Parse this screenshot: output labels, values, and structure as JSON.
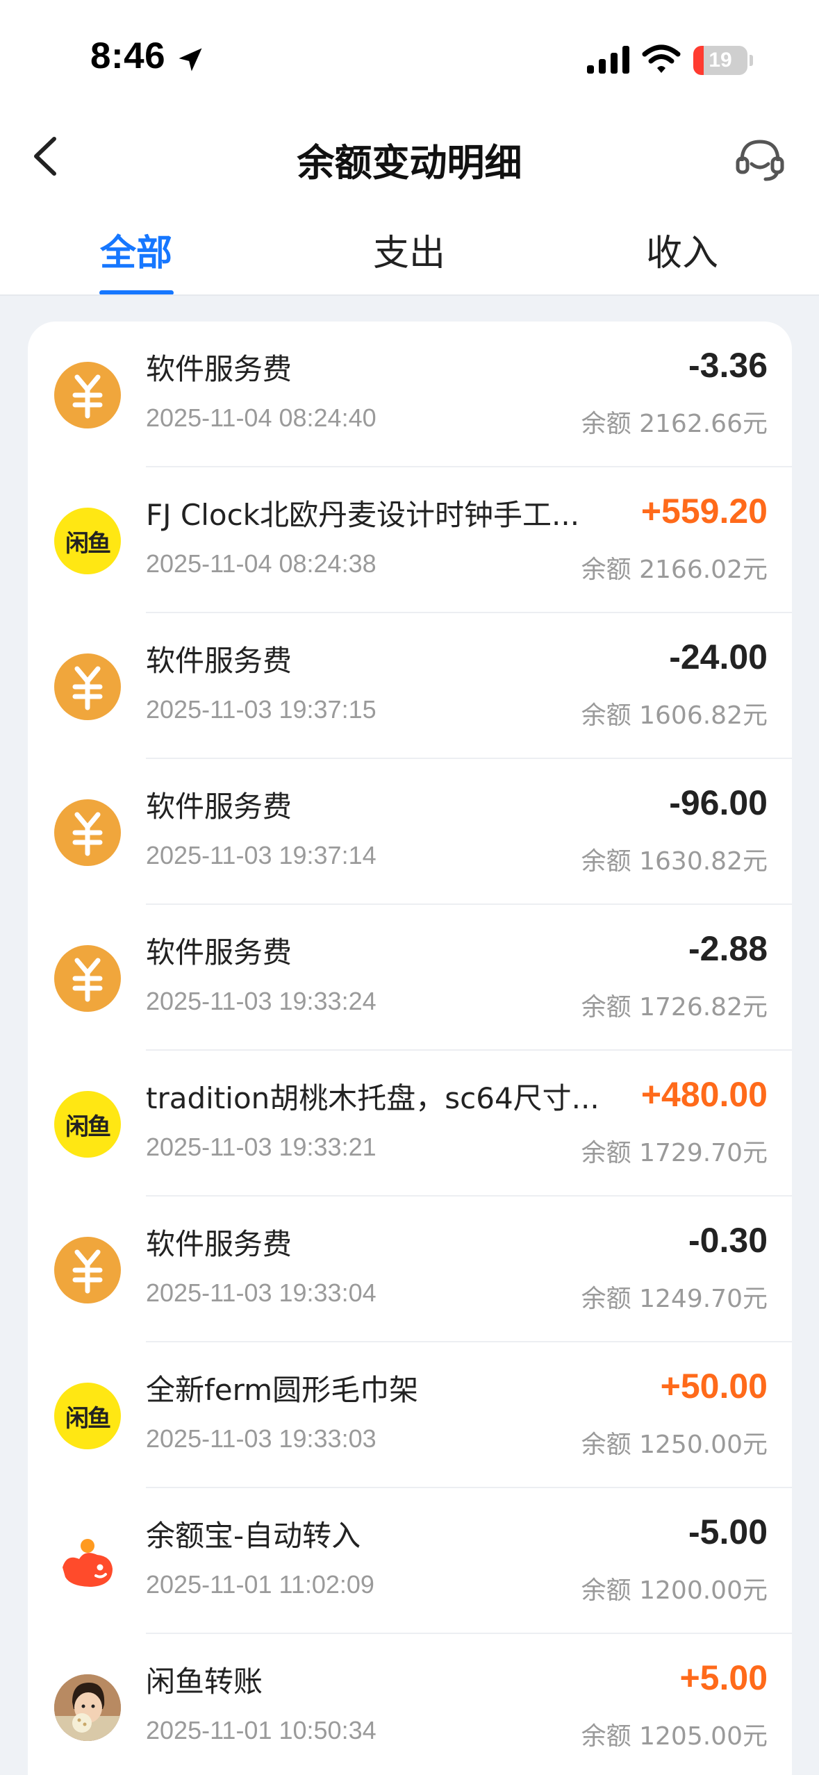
{
  "status_bar": {
    "time": "8:46",
    "battery_level": "19",
    "battery_fraction": 0.19,
    "battery_color": "#ff3b30"
  },
  "header": {
    "title": "余额变动明细",
    "back_icon": "chevron-left-icon",
    "support_icon": "customer-service-headset-icon"
  },
  "tabs": [
    {
      "label": "全部",
      "active": true
    },
    {
      "label": "支出",
      "active": false
    },
    {
      "label": "收入",
      "active": false
    }
  ],
  "accent_color": "#1677ff",
  "income_color": "#ff6a1a",
  "transactions": [
    {
      "icon": "yuan-coin-icon",
      "title": "软件服务费",
      "time": "2025-11-04 08:24:40",
      "amount": "-3.36",
      "balance": "余额 2162.66元"
    },
    {
      "icon": "xianyu-logo-icon",
      "title": "FJ Clock北欧丹麦设计时钟手工...",
      "time": "2025-11-04 08:24:38",
      "amount": "+559.20",
      "balance": "余额 2166.02元"
    },
    {
      "icon": "yuan-coin-icon",
      "title": "软件服务费",
      "time": "2025-11-03 19:37:15",
      "amount": "-24.00",
      "balance": "余额 1606.82元"
    },
    {
      "icon": "yuan-coin-icon",
      "title": "软件服务费",
      "time": "2025-11-03 19:37:14",
      "amount": "-96.00",
      "balance": "余额 1630.82元"
    },
    {
      "icon": "yuan-coin-icon",
      "title": "软件服务费",
      "time": "2025-11-03 19:33:24",
      "amount": "-2.88",
      "balance": "余额 1726.82元"
    },
    {
      "icon": "xianyu-logo-icon",
      "title": "tradition胡桃木托盘，sc64尺寸...",
      "time": "2025-11-03 19:33:21",
      "amount": "+480.00",
      "balance": "余额 1729.70元"
    },
    {
      "icon": "yuan-coin-icon",
      "title": "软件服务费",
      "time": "2025-11-03 19:33:04",
      "amount": "-0.30",
      "balance": "余额 1249.70元"
    },
    {
      "icon": "xianyu-logo-icon",
      "title": "全新ferm圆形毛巾架",
      "time": "2025-11-03 19:33:03",
      "amount": "+50.00",
      "balance": "余额 1250.00元"
    },
    {
      "icon": "yuebao-logo-icon",
      "title": "余额宝-自动转入",
      "time": "2025-11-01 11:02:09",
      "amount": "-5.00",
      "balance": "余额 1200.00元"
    },
    {
      "icon": "user-avatar-photo-icon",
      "title": "闲鱼转账",
      "time": "2025-11-01 10:50:34",
      "amount": "+5.00",
      "balance": "余额 1205.00元"
    }
  ],
  "xianyu_logo_text": "闲鱼"
}
